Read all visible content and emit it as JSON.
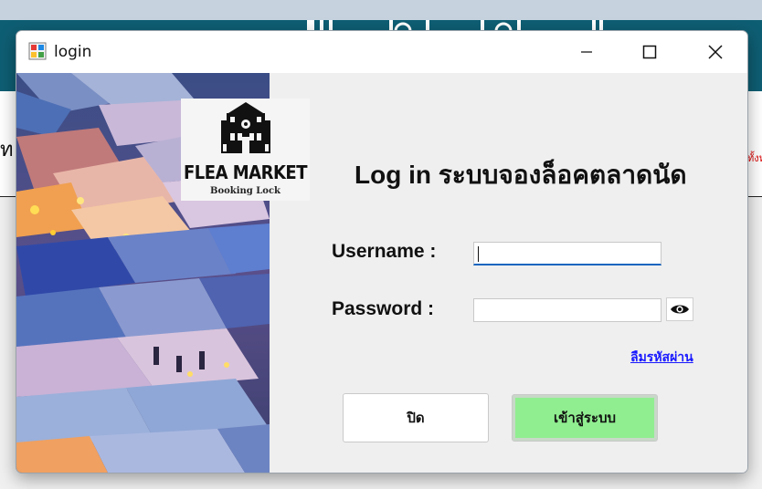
{
  "window": {
    "title": "login",
    "icon": "windows-form-icon"
  },
  "logo": {
    "title": "FLEA MARKET",
    "subtitle": "Booking Lock"
  },
  "form": {
    "heading": "Log in ระบบจองล็อคตลาดนัด",
    "username_label": "Username :",
    "username_value": "",
    "password_label": "Password :",
    "password_value": "",
    "show_password_icon": "eye-icon",
    "forgot_password": "ลืมรหัสผ่าน",
    "close_button": "ปิด",
    "login_button": "เข้าสู่ระบบ"
  },
  "colors": {
    "login_button": "#90ee90",
    "focus_underline": "#1565c0",
    "link": "#1a1aff",
    "background_header": "#0e5e73"
  }
}
